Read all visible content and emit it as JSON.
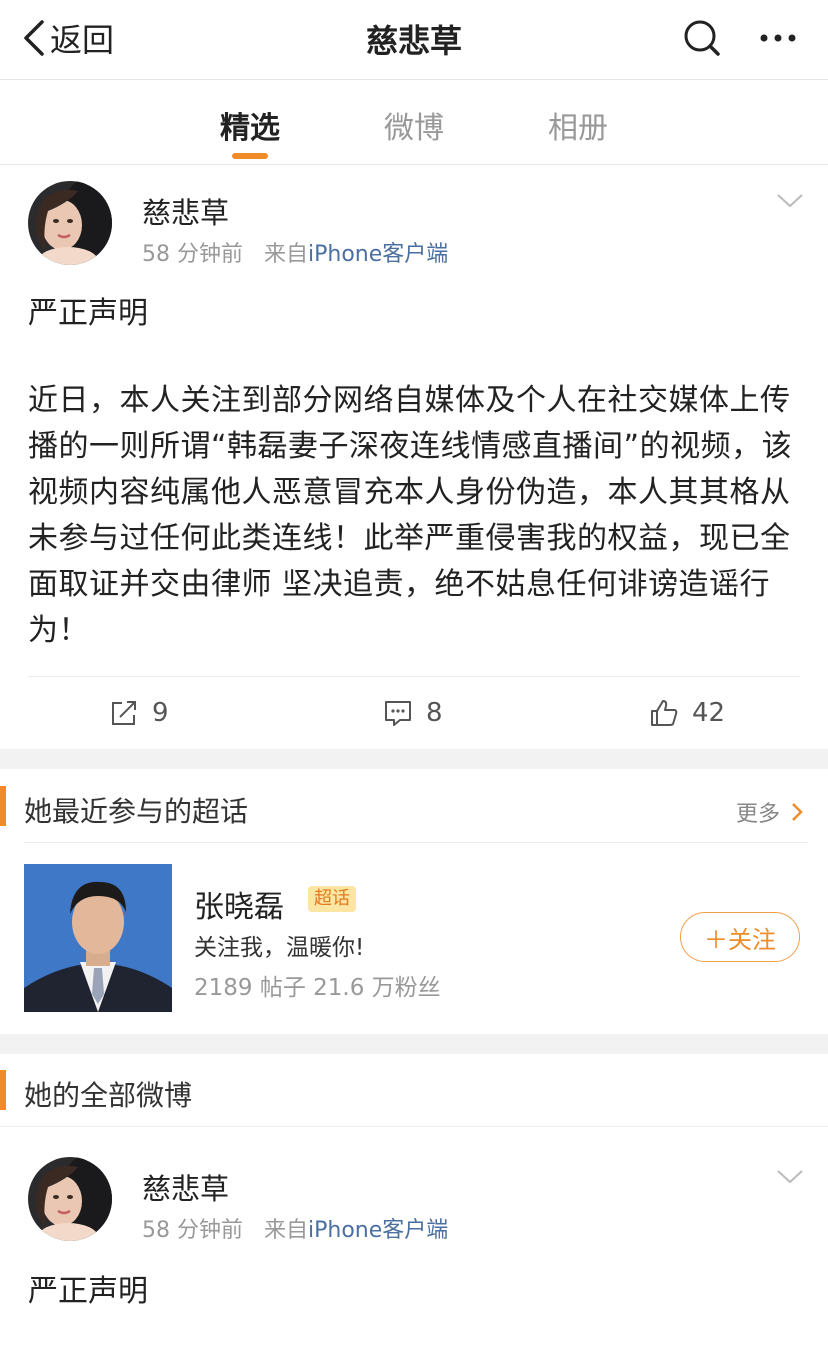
{
  "nav": {
    "back_label": "返回",
    "title": "慈悲草",
    "search_icon": "search-icon",
    "more_icon": "more-icon"
  },
  "tabs": [
    {
      "label": "精选",
      "active": true
    },
    {
      "label": "微博",
      "active": false
    },
    {
      "label": "相册",
      "active": false
    }
  ],
  "post1": {
    "author": "慈悲草",
    "time": "58 分钟前",
    "from_prefix": "来自",
    "source": "iPhone客户端",
    "title": "严正声明",
    "body": "近日，本人关注到部分网络自媒体及个人在社交媒体上传播的一则所谓“韩磊妻子深夜连线情感直播间”的视频，该视频内容纯属他人恶意冒充本人身份伪造，本人其其格从未参与过任何此类连线！此举严重侵害我的权益，现已全面取证并交由律师 坚决追责，绝不姑息任何诽谤造谣行为！",
    "reposts": "9",
    "comments": "8",
    "likes": "42"
  },
  "super_topics": {
    "section_title": "她最近参与的超话",
    "more_label": "更多",
    "item": {
      "name": "张晓磊",
      "badge": "超话",
      "desc": "关注我，温暖你!",
      "stats": "2189 帖子 21.6 万粉丝",
      "follow_label": "＋关注"
    }
  },
  "all_posts": {
    "section_title": "她的全部微博"
  },
  "post2": {
    "author": "慈悲草",
    "time": "58 分钟前",
    "from_prefix": "来自",
    "source": "iPhone客户端",
    "title": "严正声明"
  },
  "colors": {
    "accent": "#f08c28",
    "link": "#4a6fa0"
  }
}
